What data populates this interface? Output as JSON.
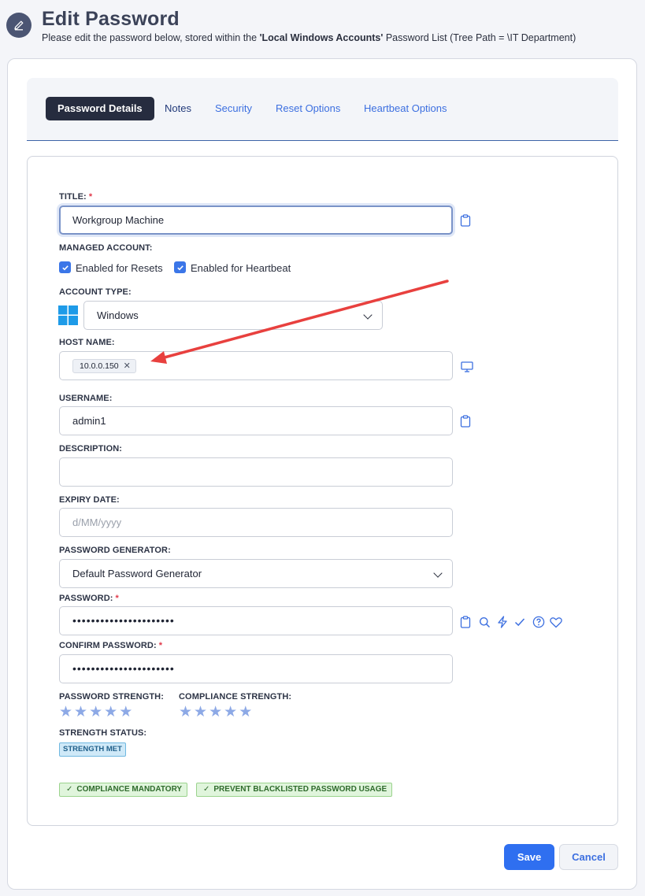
{
  "header": {
    "title": "Edit Password",
    "subtitle_pre": "Please edit the password below, stored within the ",
    "subtitle_list": "'Local Windows Accounts'",
    "subtitle_post": " Password List (Tree Path = \\IT Department)"
  },
  "tabs": [
    {
      "label": "Password Details",
      "active": true
    },
    {
      "label": "Notes",
      "active": false
    },
    {
      "label": "Security",
      "active": false
    },
    {
      "label": "Reset Options",
      "active": false
    },
    {
      "label": "Heartbeat Options",
      "active": false
    }
  ],
  "form": {
    "title_label": "TITLE:",
    "title_value": "Workgroup Machine",
    "managed_label": "MANAGED ACCOUNT:",
    "enabled_resets": "Enabled for Resets",
    "enabled_heartbeat": "Enabled for Heartbeat",
    "account_type_label": "ACCOUNT TYPE:",
    "account_type_value": "Windows",
    "host_label": "HOST NAME:",
    "host_tag": "10.0.0.150",
    "username_label": "USERNAME:",
    "username_value": "admin1",
    "description_label": "DESCRIPTION:",
    "description_value": "",
    "expiry_label": "EXPIRY DATE:",
    "expiry_placeholder": "d/MM/yyyy",
    "generator_label": "PASSWORD GENERATOR:",
    "generator_value": "Default Password Generator",
    "password_label": "PASSWORD:",
    "password_value": "••••••••••••••••••••••",
    "confirm_label": "CONFIRM PASSWORD:",
    "confirm_value": "••••••••••••••••••••••",
    "strength_label": "PASSWORD STRENGTH:",
    "compliance_label": "COMPLIANCE STRENGTH:",
    "password_strength_stars": 0,
    "compliance_strength_stars": 0,
    "status_label": "STRENGTH STATUS:",
    "status_badge": "STRENGTH MET",
    "badge_compliance": "COMPLIANCE MANDATORY",
    "badge_blacklist": "PREVENT BLACKLISTED PASSWORD USAGE"
  },
  "actions": {
    "save": "Save",
    "cancel": "Cancel"
  },
  "colors": {
    "primary": "#2f6ff0",
    "tab_active_bg": "#262c3f",
    "annotation_arrow": "#e8403e",
    "star": "#8da9e6"
  },
  "icons": [
    "edit-icon",
    "clipboard-icon",
    "windows-logo-icon",
    "monitor-icon",
    "search-icon",
    "lightning-icon",
    "check-icon",
    "help-circle-icon",
    "heart-icon"
  ]
}
